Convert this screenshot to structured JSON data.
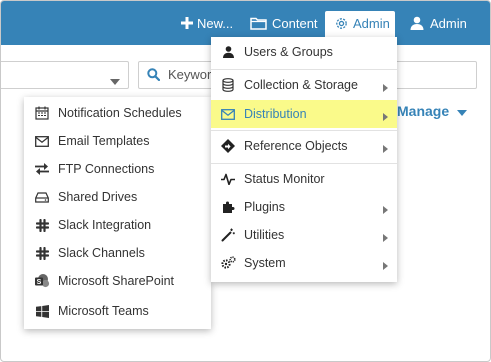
{
  "colors": {
    "topbar": "#3683b7",
    "highlight": "#fafa8a",
    "accent": "#3683b7"
  },
  "topnav": {
    "new_label": "New...",
    "content_label": "Content",
    "admin_label": "Admin",
    "user_label": "Admin"
  },
  "search": {
    "placeholder": "Keywor"
  },
  "manage": {
    "label": "Manage"
  },
  "admin_menu": {
    "items": [
      {
        "label": "Users & Groups",
        "icon": "user-icon",
        "submenu": false
      },
      {
        "label": "Collection & Storage",
        "icon": "database-icon",
        "submenu": true
      },
      {
        "label": "Distribution",
        "icon": "envelope-icon",
        "submenu": true,
        "active": true
      },
      {
        "label": "Reference Objects",
        "icon": "signpost-icon",
        "submenu": true
      },
      {
        "label": "Status Monitor",
        "icon": "pulse-icon",
        "submenu": false
      },
      {
        "label": "Plugins",
        "icon": "puzzle-icon",
        "submenu": true
      },
      {
        "label": "Utilities",
        "icon": "magic-wand-icon",
        "submenu": true
      },
      {
        "label": "System",
        "icon": "gears-icon",
        "submenu": true
      }
    ]
  },
  "distribution_menu": {
    "items": [
      {
        "label": "Notification Schedules",
        "icon": "calendar-icon"
      },
      {
        "label": "Email Templates",
        "icon": "envelope-icon"
      },
      {
        "label": "FTP Connections",
        "icon": "exchange-icon"
      },
      {
        "label": "Shared Drives",
        "icon": "drive-icon"
      },
      {
        "label": "Slack Integration",
        "icon": "slack-icon"
      },
      {
        "label": "Slack Channels",
        "icon": "slack-icon"
      },
      {
        "label": "Microsoft SharePoint",
        "icon": "sharepoint-icon"
      },
      {
        "label": "Microsoft Teams",
        "icon": "windows-icon"
      }
    ]
  }
}
